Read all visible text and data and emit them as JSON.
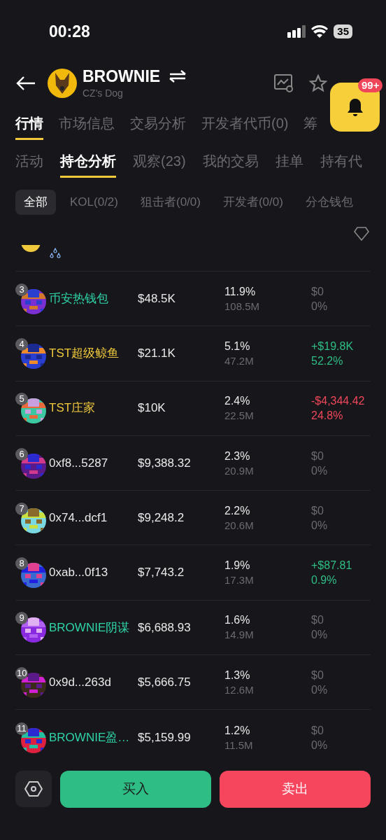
{
  "status_bar": {
    "time": "00:28",
    "battery": "35"
  },
  "header": {
    "title": "BROWNIE",
    "subtitle": "CZ's Dog",
    "notification_badge": "99+"
  },
  "tabs": [
    {
      "label": "行情",
      "selected": true
    },
    {
      "label": "市场信息",
      "selected": false
    },
    {
      "label": "交易分析",
      "selected": false
    },
    {
      "label": "开发者代币(0)",
      "selected": false
    },
    {
      "label": "筹",
      "selected": false
    }
  ],
  "subtabs": [
    {
      "label": "活动",
      "selected": false
    },
    {
      "label": "持仓分析",
      "selected": true
    },
    {
      "label": "观察(23)",
      "selected": false
    },
    {
      "label": "我的交易",
      "selected": false
    },
    {
      "label": "挂单",
      "selected": false
    },
    {
      "label": "持有代",
      "selected": false
    }
  ],
  "filters": [
    {
      "label": "全部",
      "selected": true
    },
    {
      "label": "KOL(0/2)",
      "selected": false
    },
    {
      "label": "狙击者(0/0)",
      "selected": false
    },
    {
      "label": "开发者(0/0)",
      "selected": false
    },
    {
      "label": "分仓钱包",
      "selected": false
    }
  ],
  "holders": [
    {
      "rank": "3",
      "name": "币安热钱包",
      "color": "#2ed3a8",
      "value": "$48.5K",
      "share": "11.9%",
      "amount": "108.5M",
      "pnl": {
        "value": "$0",
        "percent": "0%",
        "color": "#6b6b70"
      }
    },
    {
      "rank": "4",
      "name": "TST超级鲸鱼",
      "color": "#f0c93c",
      "value": "$21.1K",
      "share": "5.1%",
      "amount": "47.2M",
      "pnl": {
        "value": "+$19.8K",
        "percent": "52.2%",
        "color": "#2ebd85"
      }
    },
    {
      "rank": "5",
      "name": "TST庄家",
      "color": "#f0c93c",
      "value": "$10K",
      "share": "2.4%",
      "amount": "22.5M",
      "pnl": {
        "value": "-$4,344.42",
        "percent": "24.8%",
        "color": "#f0465a"
      }
    },
    {
      "rank": "6",
      "name": "0xf8...5287",
      "color": "#e8e8e8",
      "value": "$9,388.32",
      "share": "2.3%",
      "amount": "20.9M",
      "pnl": {
        "value": "$0",
        "percent": "0%",
        "color": "#6b6b70"
      }
    },
    {
      "rank": "7",
      "name": "0x74...dcf1",
      "color": "#e8e8e8",
      "value": "$9,248.2",
      "share": "2.2%",
      "amount": "20.6M",
      "pnl": {
        "value": "$0",
        "percent": "0%",
        "color": "#6b6b70"
      }
    },
    {
      "rank": "8",
      "name": "0xab...0f13",
      "color": "#e8e8e8",
      "value": "$7,743.2",
      "share": "1.9%",
      "amount": "17.3M",
      "pnl": {
        "value": "+$87.81",
        "percent": "0.9%",
        "color": "#2ebd85"
      }
    },
    {
      "rank": "9",
      "name": "BROWNIE阴谋",
      "color": "#2ed3a8",
      "value": "$6,688.93",
      "share": "1.6%",
      "amount": "14.9M",
      "pnl": {
        "value": "$0",
        "percent": "0%",
        "color": "#6b6b70"
      }
    },
    {
      "rank": "10",
      "name": "0x9d...263d",
      "color": "#e8e8e8",
      "value": "$5,666.75",
      "share": "1.3%",
      "amount": "12.6M",
      "pnl": {
        "value": "$0",
        "percent": "0%",
        "color": "#6b6b70"
      }
    },
    {
      "rank": "11",
      "name": "BROWNIE盈…",
      "color": "#2ed3a8",
      "value": "$5,159.99",
      "share": "1.2%",
      "amount": "11.5M",
      "pnl": {
        "value": "$0",
        "percent": "0%",
        "color": "#6b6b70"
      }
    }
  ],
  "actions": {
    "buy": "买入",
    "sell": "卖出"
  }
}
